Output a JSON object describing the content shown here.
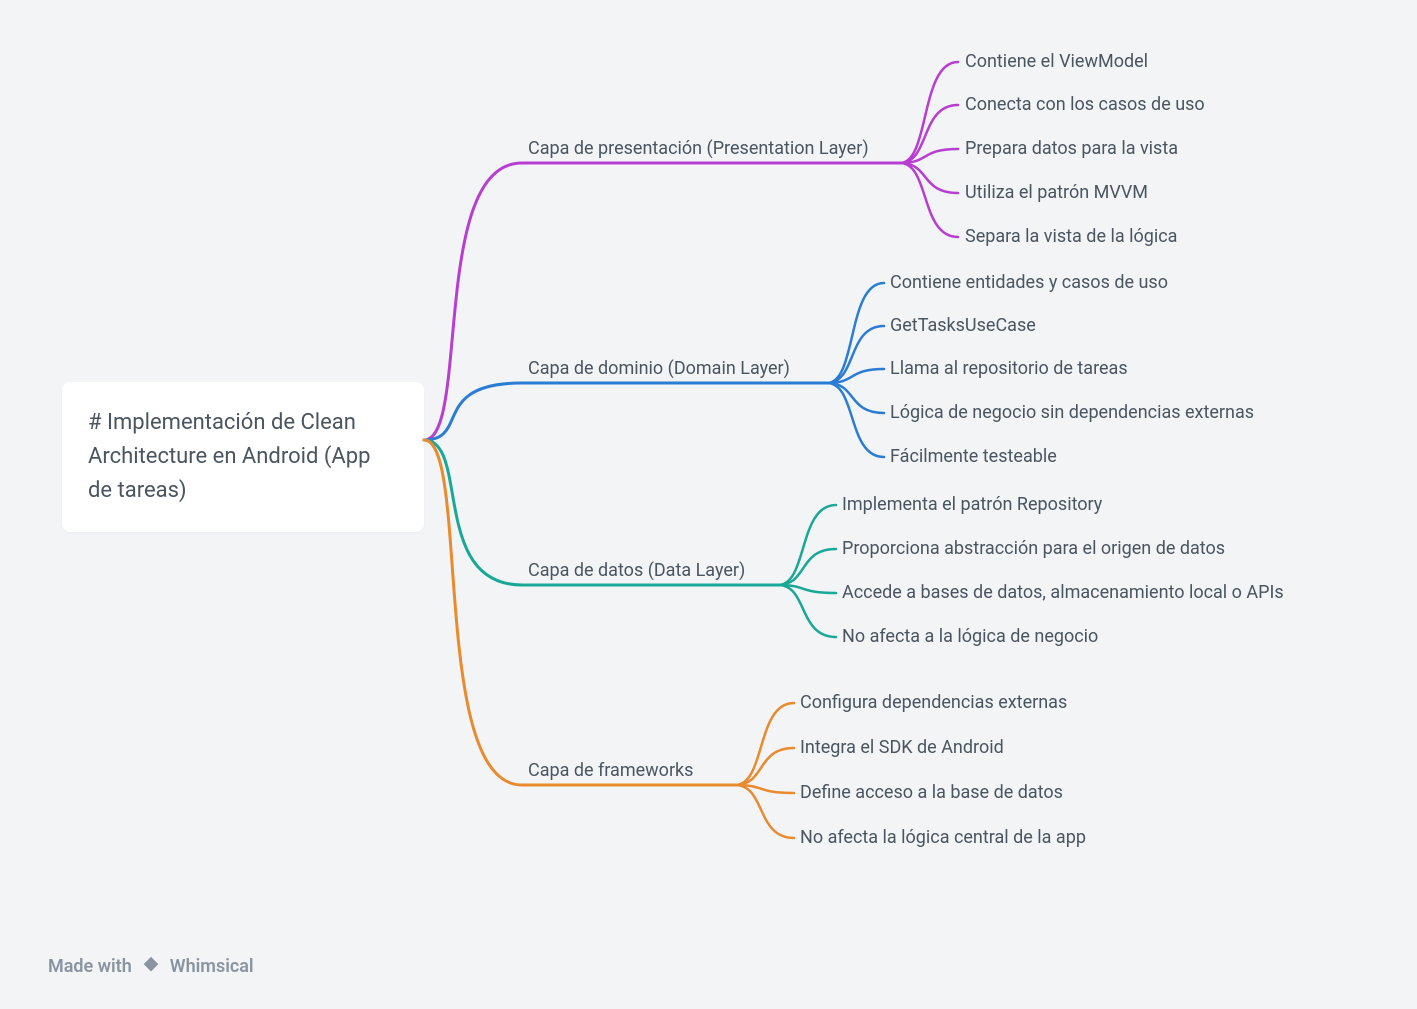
{
  "root": {
    "title": "# Implementación de Clean Architecture en Android (App de tareas)"
  },
  "colors": {
    "purple": "#b83dd1",
    "blue": "#2b7cd3",
    "teal": "#1aa896",
    "orange": "#e98a2e"
  },
  "branches": [
    {
      "id": "presentation",
      "label": "Capa de presentación (Presentation Layer)",
      "color": "purple",
      "children": [
        "Contiene el ViewModel",
        "Conecta con los casos de uso",
        "Prepara datos para la vista",
        "Utiliza el patrón MVVM",
        "Separa la vista de la lógica"
      ]
    },
    {
      "id": "domain",
      "label": "Capa de dominio (Domain Layer)",
      "color": "blue",
      "children": [
        "Contiene entidades y casos de uso",
        "GetTasksUseCase",
        "Llama al repositorio de tareas",
        "Lógica de negocio sin dependencias externas",
        "Fácilmente testeable"
      ]
    },
    {
      "id": "data",
      "label": "Capa de datos (Data Layer)",
      "color": "teal",
      "children": [
        "Implementa el patrón Repository",
        "Proporciona abstracción para el origen de datos",
        "Accede a bases de datos, almacenamiento local o APIs",
        "No afecta a la lógica de negocio"
      ]
    },
    {
      "id": "frameworks",
      "label": "Capa de frameworks",
      "color": "orange",
      "children": [
        "Configura dependencias externas",
        "Integra el SDK de Android",
        "Define acceso a la base de datos",
        "No afecta la lógica central de la app"
      ]
    }
  ],
  "footer": {
    "made_with": "Made with",
    "brand": "Whimsical"
  }
}
